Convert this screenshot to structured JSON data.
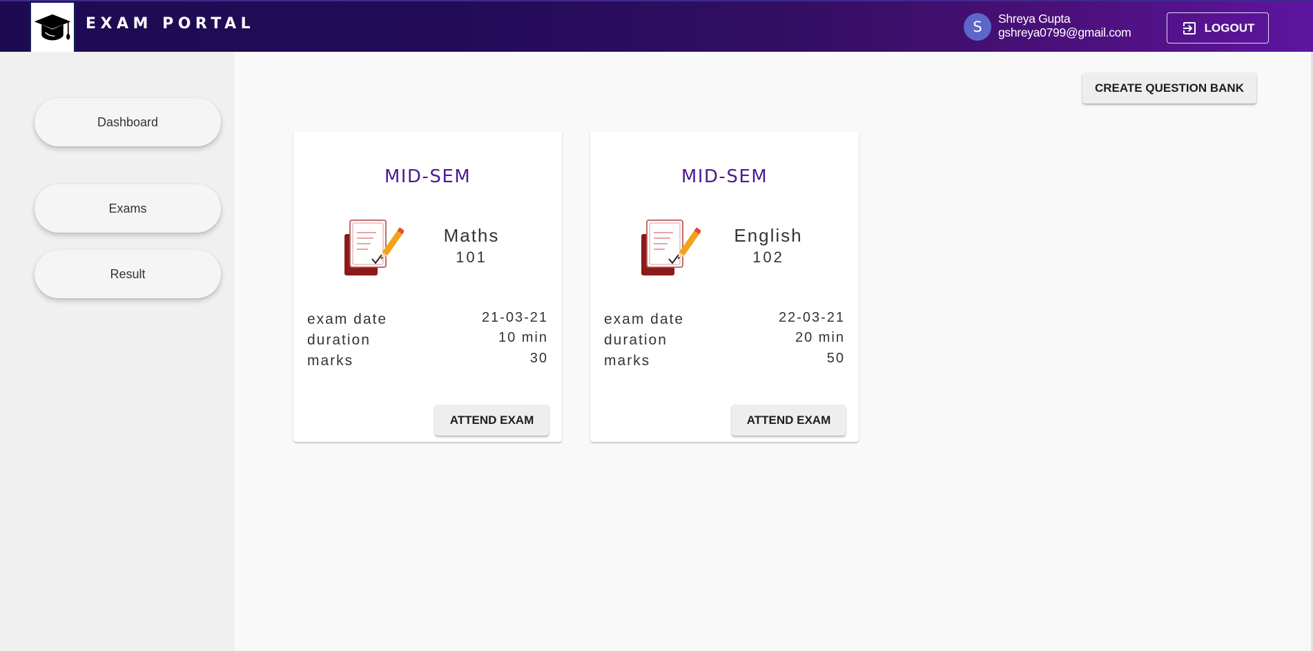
{
  "header": {
    "brand": "EXAM PORTAL",
    "logo_icon": "graduation-cap-icon",
    "user": {
      "avatar_initial": "S",
      "name": "Shreya Gupta",
      "email": "gshreya0799@gmail.com"
    },
    "logout_label": "LOGOUT",
    "logout_icon": "logout-icon"
  },
  "sidebar": {
    "items": [
      {
        "label": "Dashboard"
      },
      {
        "label": "Exams"
      },
      {
        "label": "Result"
      }
    ]
  },
  "main": {
    "create_label": "CREATE QUESTION BANK",
    "cards": [
      {
        "title": "MID-SEM",
        "subject": "Maths",
        "code": "101",
        "icon": "exam-paper-icon",
        "rows": [
          {
            "label": "exam date",
            "value": "21-03-21"
          },
          {
            "label": "duration",
            "value": "10 min"
          },
          {
            "label": "marks",
            "value": "30"
          }
        ],
        "button_label": "ATTEND EXAM"
      },
      {
        "title": "MID-SEM",
        "subject": "English",
        "code": "102",
        "icon": "exam-paper-icon",
        "rows": [
          {
            "label": "exam date",
            "value": "22-03-21"
          },
          {
            "label": "duration",
            "value": "20 min"
          },
          {
            "label": "marks",
            "value": "50"
          }
        ],
        "button_label": "ATTEND EXAM"
      }
    ]
  },
  "colors": {
    "header_start": "#1d0b52",
    "header_end": "#5e15a0",
    "card_title": "#4a1a95",
    "avatar": "#5c67c9"
  }
}
